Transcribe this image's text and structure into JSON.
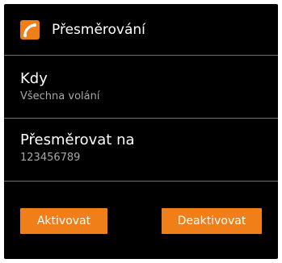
{
  "header": {
    "title": "Přesměrování",
    "icon": "phone-forward-icon"
  },
  "items": [
    {
      "title": "Kdy",
      "value": "Všechna volání"
    },
    {
      "title": "Přesměrovat na",
      "value": "123456789"
    }
  ],
  "buttons": {
    "activate": "Aktivovat",
    "deactivate": "Deaktivovat"
  },
  "colors": {
    "accent": "#f07f1a",
    "background": "#000000",
    "divider": "#6e6e6e",
    "subtext": "#a8a8a8"
  }
}
